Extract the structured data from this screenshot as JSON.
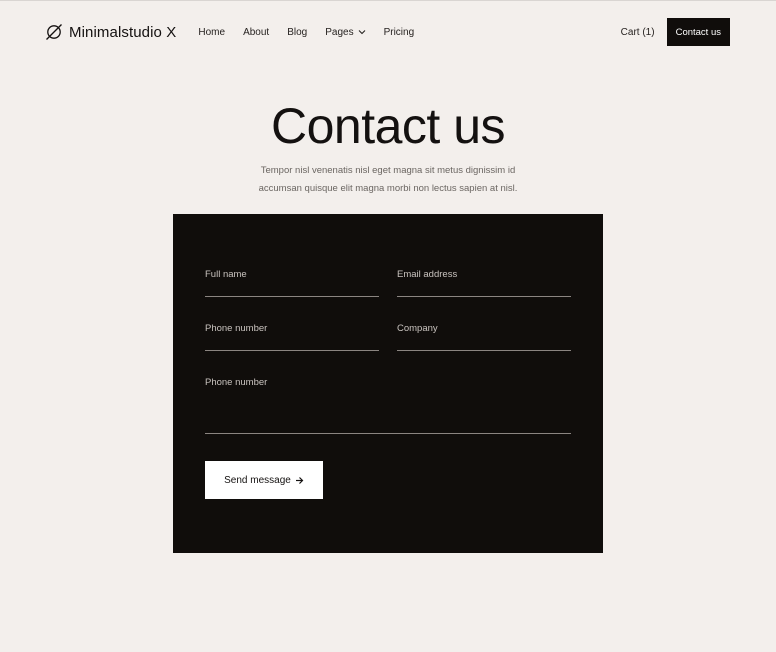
{
  "header": {
    "brand": "Minimalstudio X",
    "brand_icon": "planet-icon",
    "nav": [
      {
        "label": "Home"
      },
      {
        "label": "About"
      },
      {
        "label": "Blog"
      },
      {
        "label": "Pages",
        "icon": "chevron-down-icon"
      },
      {
        "label": "Pricing"
      }
    ],
    "cart": "Cart (1)",
    "contact_button": "Contact us"
  },
  "hero": {
    "title": "Contact us",
    "text_line1": "Tempor nisl venenatis nisl eget magna sit metus dignissim id",
    "text_line2": "accumsan quisque elit magna morbi non lectus sapien at nisl."
  },
  "form": {
    "fields": {
      "full_name": {
        "label": "Full name",
        "value": ""
      },
      "email": {
        "label": "Email address",
        "value": ""
      },
      "phone": {
        "label": "Phone number",
        "value": ""
      },
      "company": {
        "label": "Company",
        "value": ""
      },
      "message": {
        "label": "Phone number",
        "value": ""
      }
    },
    "submit_label": "Send message",
    "submit_icon": "arrow-right-icon"
  },
  "colors": {
    "background": "#f3efec",
    "card": "#100d0b",
    "text": "#141110",
    "muted": "#6b6662"
  }
}
